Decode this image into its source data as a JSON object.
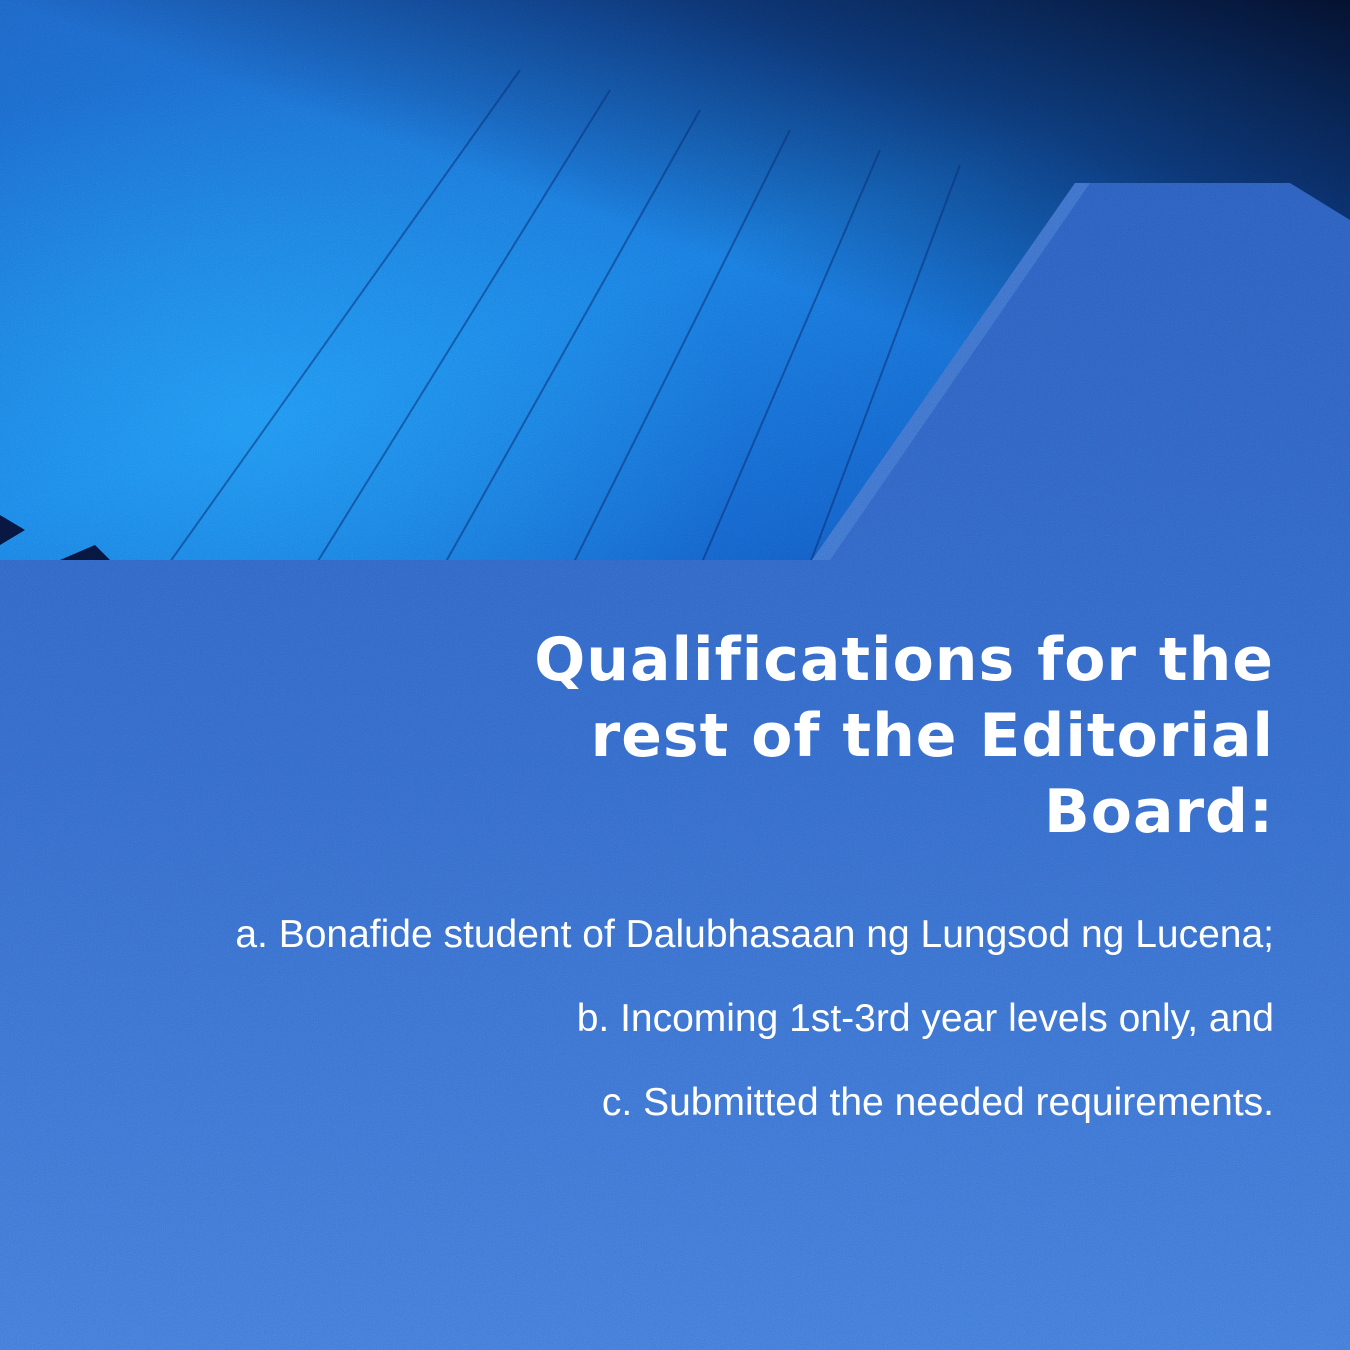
{
  "title_lines": [
    "Qualifications for the",
    "rest of the Editorial",
    "Board:"
  ],
  "qualifications": [
    "a. Bonafide student of Dalubhasaan ng Lungsod ng Lucena;",
    "b. Incoming 1st-3rd year levels only, and",
    "c. Submitted the needed requirements."
  ],
  "colors": {
    "panel_top": "#2e5fbf",
    "panel_bottom": "#4277d6",
    "text": "#ffffff",
    "photo_light": "#1a7ae0",
    "photo_dark": "#05102b"
  }
}
